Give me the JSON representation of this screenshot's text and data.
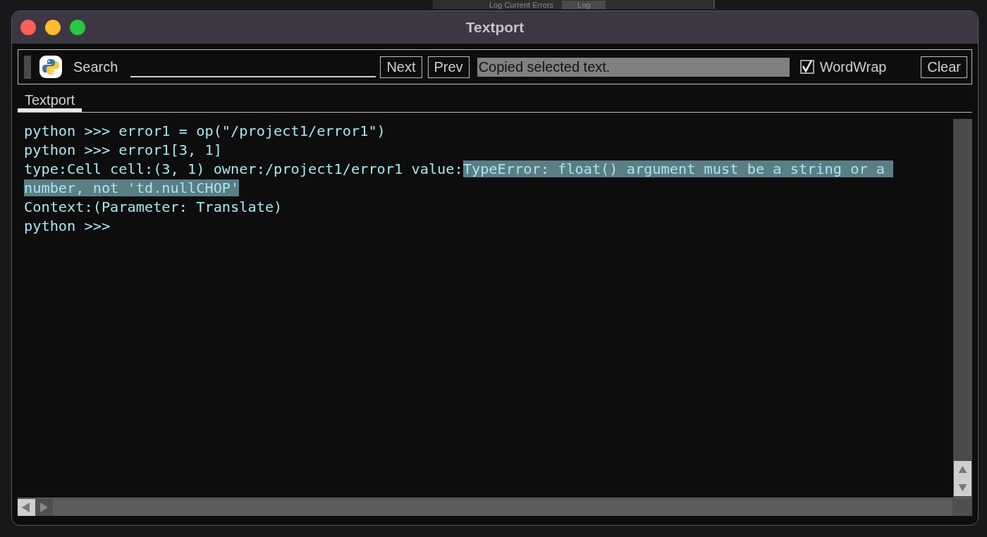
{
  "background_window": {
    "label": "Log Current Errors",
    "button": "Log"
  },
  "window": {
    "title": "Textport"
  },
  "toolbar": {
    "search_label": "Search",
    "buttons": [
      "Next",
      "Prev"
    ],
    "status": "Copied selected text.",
    "wordwrap": {
      "label": "WordWrap",
      "checked": true
    },
    "clear": "Clear"
  },
  "tabs": [
    {
      "label": "Textport",
      "selected": true
    }
  ],
  "console": {
    "lines": [
      {
        "segments": [
          {
            "text": "python >>> error1 = op(\"/project1/error1\")",
            "selected": false
          }
        ]
      },
      {
        "segments": [
          {
            "text": "python >>> error1[3, 1]",
            "selected": false
          }
        ]
      },
      {
        "segments": [
          {
            "text": "type:Cell cell:(3, 1) owner:/project1/error1 value:",
            "selected": false
          },
          {
            "text": "TypeError: float() argument must be a string or a number, not 'td.nullCHOP'",
            "selected": true
          }
        ]
      },
      {
        "segments": [
          {
            "text": "Context:(Parameter: Translate)",
            "selected": false
          }
        ]
      },
      {
        "segments": [
          {
            "text": "python >>>",
            "selected": false
          }
        ]
      }
    ]
  }
}
